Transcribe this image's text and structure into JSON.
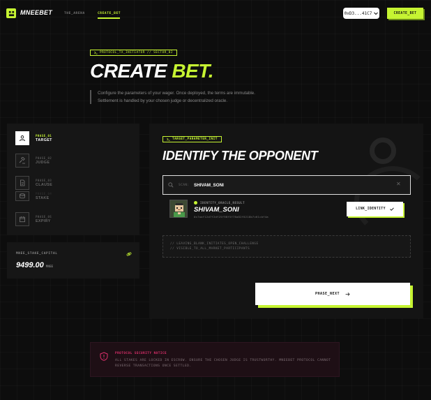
{
  "header": {
    "logo_text": "MNEEBET",
    "nav": [
      {
        "label": "THE_ARENA",
        "active": false
      },
      {
        "label": "CREATE_BET",
        "active": true
      }
    ],
    "wallet": "0xD3...41C7",
    "create_button": "CREATE_BET"
  },
  "hero": {
    "tag": "PROTOCOL_TX_INITIATOR // SECTOR_02",
    "title_main": "CREATE",
    "title_accent": "BET.",
    "description_line1": "Configure the parameters of your wager. Once deployed, the terms are immutable.",
    "description_line2": "Settlement is handled by your chosen judge or decentralized oracle."
  },
  "steps": [
    {
      "phase": "PHASE_01",
      "label": "TARGET",
      "icon": "user-icon",
      "active": true
    },
    {
      "phase": "PHASE_02",
      "label": "JUDGE",
      "icon": "gavel-icon",
      "active": false
    },
    {
      "phase": "PHASE_03",
      "label": "CLAUSE",
      "icon": "document-icon",
      "active": false
    },
    {
      "phase": "PHASE_04",
      "label": "STAKE",
      "icon": "coins-icon",
      "active": false
    },
    {
      "phase": "PHASE_05",
      "label": "EXPIRY",
      "icon": "calendar-icon",
      "active": false
    }
  ],
  "stake": {
    "title": "MNEE_STAKE_CAPITAL",
    "value": "9499.00",
    "unit": "MNEE"
  },
  "main": {
    "tag": "TARGET_PARAMETER_INIT",
    "title": "IDENTIFY THE OPPONENT",
    "search_prefix": "SCAN:",
    "search_value": "SHIVAM_SONI",
    "result": {
      "oracle_label": "IDENTITY_ORACLE_RESULT",
      "name": "SHIVAM_SONI",
      "address": "0x7aaf12d7f2df25f98f5f78a82f0218b7c61cbf4a",
      "link_button": "LINK_IDENTITY"
    },
    "log_line1": "// LEAVING_BLANK_INITIATES_OPEN_CHALLENGE",
    "log_line2": "// VISIBLE_TO_ALL_MARKET_PARTICIPANTS",
    "next_button": "PHASE_NEXT"
  },
  "notice": {
    "title": "PROTOCOL SECURITY NOTICE",
    "body": "ALL STAKES ARE LOCKED IN ESCROW. ENSURE THE CHOSEN JUDGE IS TRUSTWORTHY. MNEEBET PROTOCOL CANNOT REVERSE TRANSACTIONS ONCE SETTLED."
  },
  "colors": {
    "accent": "#c6f432",
    "background": "#0d0d0d",
    "panel": "#161616",
    "danger": "#e0306d"
  }
}
